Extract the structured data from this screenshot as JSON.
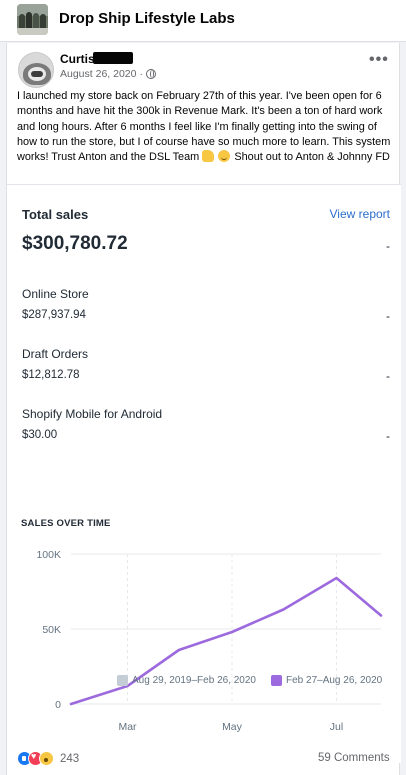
{
  "group": {
    "name": "Drop Ship Lifestyle Labs"
  },
  "post": {
    "author": "Curtis",
    "date": "August 26, 2020",
    "body_main": "I launched my store back on February 27th of this year. I've been open for 6 months and have hit the 300k in Revenue Mark. It's been a ton of hard work and long hours. After 6 months I feel like I'm finally getting into the swing of how to run the store, but I of course have so much more to learn. This system works! Trust Anton and the DSL Team",
    "body_tail": "Shout out to Anton & Johnny FD",
    "more_label": "•••"
  },
  "report": {
    "title": "Total sales",
    "view_report": "View report",
    "total": "$300,780.72",
    "total_change": "-",
    "rows": [
      {
        "label": "Online Store",
        "value": "$287,937.94",
        "change": "-"
      },
      {
        "label": "Draft Orders",
        "value": "$12,812.78",
        "change": "-"
      },
      {
        "label": "Shopify Mobile for Android",
        "value": "$30.00",
        "change": "-"
      }
    ]
  },
  "chart_data": {
    "type": "line",
    "title": "SALES OVER TIME",
    "x_ticks": [
      "Mar",
      "May",
      "Jul"
    ],
    "y_ticks": [
      "100K",
      "50K",
      "0"
    ],
    "ylim": [
      0,
      100000
    ],
    "grid": true,
    "legend_position": "bottom-right",
    "series": [
      {
        "name": "Aug 29, 2019–Feb 26, 2020",
        "color": "#c4cdd5",
        "points": []
      },
      {
        "name": "Feb 27–Aug 26, 2020",
        "color": "#9c6ade",
        "points": [
          {
            "x": "2020-02-27",
            "y": 0
          },
          {
            "x": "2020-03-31",
            "y": 12000
          },
          {
            "x": "2020-04-30",
            "y": 36000
          },
          {
            "x": "2020-05-31",
            "y": 48000
          },
          {
            "x": "2020-06-30",
            "y": 63000
          },
          {
            "x": "2020-07-31",
            "y": 84000
          },
          {
            "x": "2020-08-26",
            "y": 59000
          }
        ]
      }
    ]
  },
  "footer": {
    "reaction_count": "243",
    "comments": "59 Comments"
  },
  "colors": {
    "link": "#2c6ecb",
    "line_current": "#9c6ade",
    "line_previous": "#c4cdd5"
  }
}
